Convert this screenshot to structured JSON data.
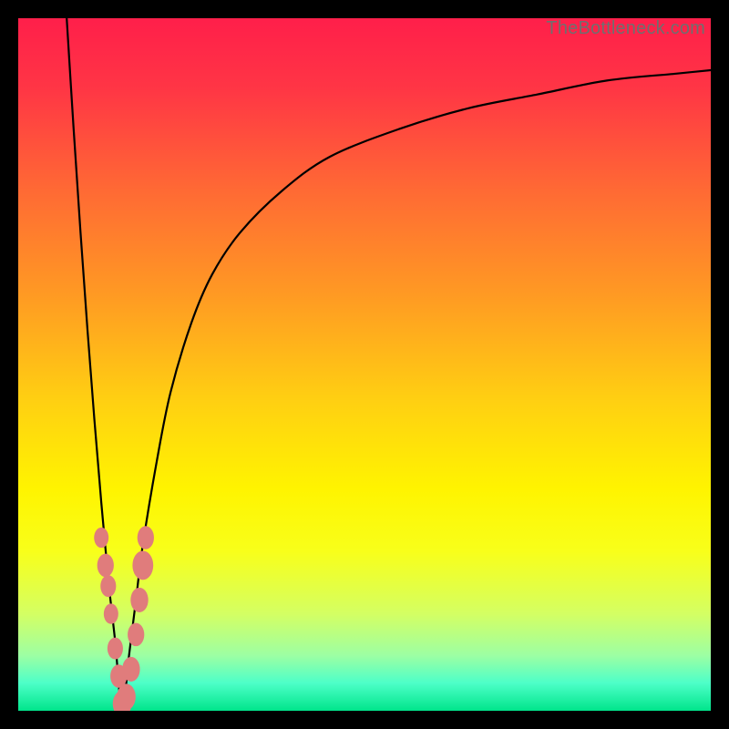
{
  "watermark": "TheBottleneck.com",
  "colors": {
    "gradient_stops": [
      {
        "offset": 0.0,
        "color": "#ff1f4a"
      },
      {
        "offset": 0.1,
        "color": "#ff3545"
      },
      {
        "offset": 0.25,
        "color": "#ff6a34"
      },
      {
        "offset": 0.4,
        "color": "#ff9a23"
      },
      {
        "offset": 0.55,
        "color": "#ffcf12"
      },
      {
        "offset": 0.68,
        "color": "#fff400"
      },
      {
        "offset": 0.77,
        "color": "#f8ff1a"
      },
      {
        "offset": 0.86,
        "color": "#d4ff63"
      },
      {
        "offset": 0.92,
        "color": "#9dffa3"
      },
      {
        "offset": 0.96,
        "color": "#4dffc8"
      },
      {
        "offset": 1.0,
        "color": "#00e58b"
      }
    ],
    "curve": "#000000",
    "marker_fill": "#e07c7c",
    "marker_stroke": "#8a3a3a"
  },
  "chart_data": {
    "type": "line",
    "title": "",
    "xlabel": "",
    "ylabel": "",
    "x_range": [
      0,
      100
    ],
    "y_range": [
      0,
      100
    ],
    "series": [
      {
        "name": "bottleneck-curve",
        "note": "V-shaped curve. Minimum (0%) near x≈15. Left arm rises to 100% at x≈7. Right arm rises asymptotically toward ~93% by x=100.",
        "x": [
          7,
          8,
          9,
          10,
          11,
          12,
          13,
          14,
          15,
          16,
          17,
          18,
          20,
          22,
          25,
          28,
          32,
          38,
          45,
          55,
          65,
          75,
          85,
          95,
          100
        ],
        "y": [
          100,
          84,
          69,
          55,
          42,
          30,
          19,
          10,
          0,
          8,
          16,
          24,
          36,
          46,
          56,
          63,
          69,
          75,
          80,
          84,
          87,
          89,
          91,
          92,
          92.5
        ]
      }
    ],
    "markers": {
      "name": "highlighted-points",
      "points": [
        {
          "x": 12.0,
          "y": 25,
          "r": 1.4
        },
        {
          "x": 12.6,
          "y": 21,
          "r": 1.6
        },
        {
          "x": 13.0,
          "y": 18,
          "r": 1.5
        },
        {
          "x": 13.4,
          "y": 14,
          "r": 1.4
        },
        {
          "x": 14.0,
          "y": 9,
          "r": 1.5
        },
        {
          "x": 14.5,
          "y": 5,
          "r": 1.6
        },
        {
          "x": 15.0,
          "y": 1,
          "r": 1.8
        },
        {
          "x": 15.6,
          "y": 2,
          "r": 1.8
        },
        {
          "x": 16.3,
          "y": 6,
          "r": 1.7
        },
        {
          "x": 17.0,
          "y": 11,
          "r": 1.6
        },
        {
          "x": 17.5,
          "y": 16,
          "r": 1.7
        },
        {
          "x": 18.0,
          "y": 21,
          "r": 2.0
        },
        {
          "x": 18.4,
          "y": 25,
          "r": 1.6
        }
      ]
    }
  }
}
